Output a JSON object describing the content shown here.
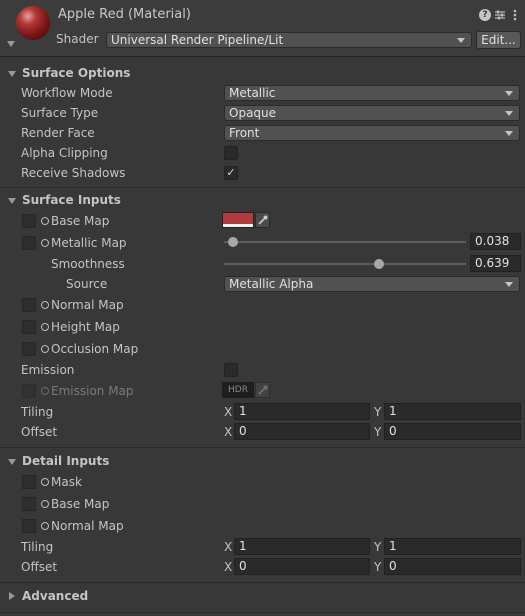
{
  "header": {
    "title": "Apple Red (Material)",
    "shader_label": "Shader",
    "shader_value": "Universal Render Pipeline/Lit",
    "edit_label": "Edit..."
  },
  "surface_options": {
    "title": "Surface Options",
    "workflow_mode_label": "Workflow Mode",
    "workflow_mode_value": "Metallic",
    "surface_type_label": "Surface Type",
    "surface_type_value": "Opaque",
    "render_face_label": "Render Face",
    "render_face_value": "Front",
    "alpha_clipping_label": "Alpha Clipping",
    "alpha_clipping_checked": false,
    "receive_shadows_label": "Receive Shadows",
    "receive_shadows_checked": true
  },
  "surface_inputs": {
    "title": "Surface Inputs",
    "base_map_label": "Base Map",
    "base_map_color": "#b23b3f",
    "metallic_map_label": "Metallic Map",
    "metallic_value": "0.038",
    "metallic_fraction": 0.038,
    "smoothness_label": "Smoothness",
    "smoothness_value": "0.639",
    "smoothness_fraction": 0.639,
    "source_label": "Source",
    "source_value": "Metallic Alpha",
    "normal_map_label": "Normal Map",
    "height_map_label": "Height Map",
    "occlusion_map_label": "Occlusion Map",
    "emission_label": "Emission",
    "emission_checked": false,
    "emission_map_label": "Emission Map",
    "hdr_label": "HDR",
    "tiling_label": "Tiling",
    "tiling_x": "1",
    "tiling_y": "1",
    "offset_label": "Offset",
    "offset_x": "0",
    "offset_y": "0",
    "x_label": "X",
    "y_label": "Y"
  },
  "detail_inputs": {
    "title": "Detail Inputs",
    "mask_label": "Mask",
    "base_map_label": "Base Map",
    "normal_map_label": "Normal Map",
    "tiling_label": "Tiling",
    "tiling_x": "1",
    "tiling_y": "1",
    "offset_label": "Offset",
    "offset_x": "0",
    "offset_y": "0",
    "x_label": "X",
    "y_label": "Y"
  },
  "advanced": {
    "title": "Advanced"
  },
  "icons": {
    "help": "help-icon",
    "presets": "presets-icon",
    "menu": "more-menu-icon",
    "check": "✓"
  }
}
